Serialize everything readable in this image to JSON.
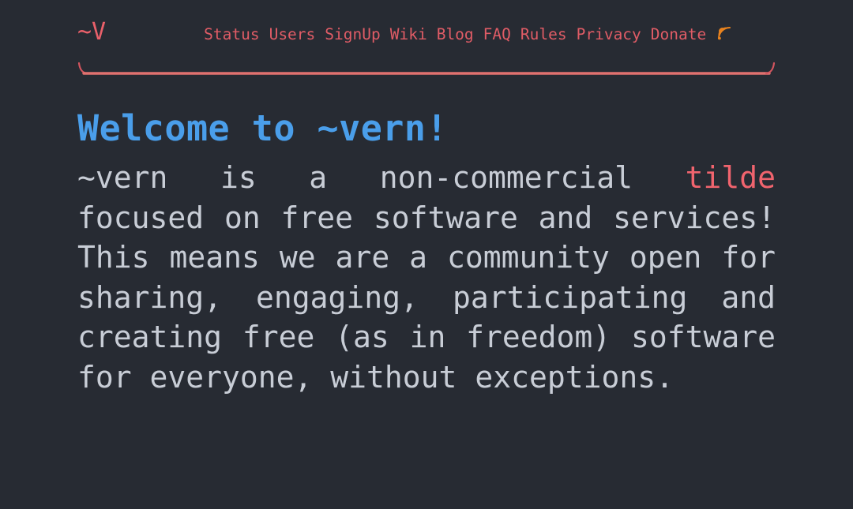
{
  "site": {
    "background_color": "#272b33",
    "logo_text": "~V",
    "logo_color": "#e9606a"
  },
  "header": {
    "nav_items": [
      {
        "label": "Status"
      },
      {
        "label": "Users"
      },
      {
        "label": "SignUp"
      },
      {
        "label": "Wiki"
      },
      {
        "label": "Blog"
      },
      {
        "label": "FAQ"
      },
      {
        "label": "Rules"
      },
      {
        "label": "Privacy"
      },
      {
        "label": "Donate"
      }
    ],
    "nav_link_color": "#e05c66",
    "rss_icon": "rss-feed-icon",
    "rss_icon_color": "#e8821e",
    "divider_color": "#e06a6a"
  },
  "main": {
    "title": "Welcome to ~vern!",
    "title_color": "#4a9eea",
    "intro": {
      "before_link": "~vern is a non-commercial ",
      "link_text": "tilde",
      "link_color": "#f0646e",
      "after_link": " focused on free software and services! This means we are a community open for sharing, engaging, participating and creating free (as in freedom) software for everyone, without exceptions.",
      "text_color": "#c8cdd6"
    }
  }
}
